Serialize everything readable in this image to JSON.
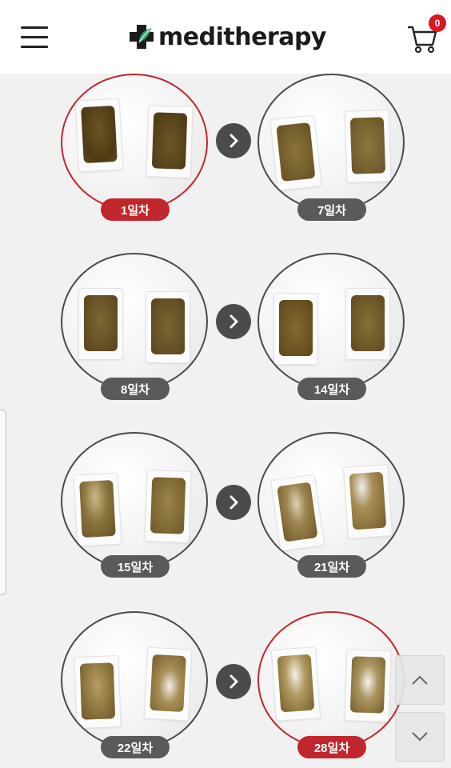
{
  "header": {
    "brand": "meditherapy",
    "menu_icon": "hamburger-menu-icon",
    "logo_icon": "cross-leaf-logo-icon",
    "cart_icon": "shopping-cart-icon",
    "cart_count": "0",
    "accent_color": "#d71920"
  },
  "comparisons": [
    {
      "before_label": "1일차",
      "after_label": "7일차",
      "before_highlight": true,
      "after_highlight": false
    },
    {
      "before_label": "8일차",
      "after_label": "14일차",
      "before_highlight": false,
      "after_highlight": false
    },
    {
      "before_label": "15일차",
      "after_label": "21일차",
      "before_highlight": false,
      "after_highlight": false
    },
    {
      "before_label": "22일차",
      "after_label": "28일차",
      "before_highlight": false,
      "after_highlight": true
    }
  ],
  "colors": {
    "highlight": "#c0272d",
    "badge_gray": "#5a5a5a",
    "arrow": "#4b4b4b"
  },
  "controls": {
    "scroll_up_icon": "chevron-up-icon",
    "scroll_down_icon": "chevron-down-icon",
    "arrow_icon": "chevron-right-icon"
  }
}
